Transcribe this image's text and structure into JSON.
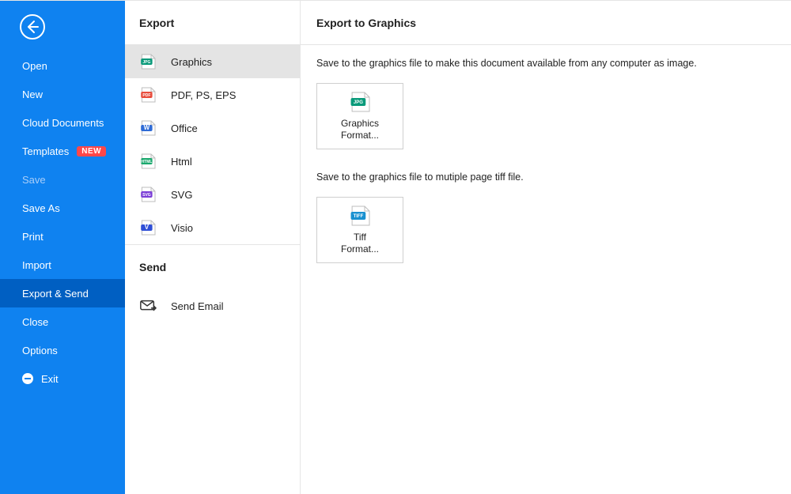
{
  "nav": {
    "items": [
      {
        "label": "Open"
      },
      {
        "label": "New"
      },
      {
        "label": "Cloud Documents"
      },
      {
        "label": "Templates",
        "badge": "NEW"
      },
      {
        "label": "Save",
        "disabled": true
      },
      {
        "label": "Save As"
      },
      {
        "label": "Print"
      },
      {
        "label": "Import"
      },
      {
        "label": "Export & Send",
        "active": true
      },
      {
        "label": "Close"
      },
      {
        "label": "Options"
      },
      {
        "label": "Exit",
        "exitIcon": true
      }
    ]
  },
  "middle": {
    "exportHeader": "Export",
    "exportItems": [
      {
        "label": "Graphics",
        "icon": "jpg",
        "selected": true
      },
      {
        "label": "PDF, PS, EPS",
        "icon": "pdf"
      },
      {
        "label": "Office",
        "icon": "word"
      },
      {
        "label": "Html",
        "icon": "html"
      },
      {
        "label": "SVG",
        "icon": "svg"
      },
      {
        "label": "Visio",
        "icon": "visio"
      }
    ],
    "sendHeader": "Send",
    "sendItems": [
      {
        "label": "Send Email",
        "icon": "email"
      }
    ]
  },
  "main": {
    "title": "Export to Graphics",
    "sections": [
      {
        "desc": "Save to the graphics file to make this document available from any computer as image.",
        "card": {
          "label": "Graphics Format...",
          "icon": "jpg"
        }
      },
      {
        "desc": "Save to the graphics file to mutiple page tiff file.",
        "card": {
          "label": "Tiff Format...",
          "icon": "tiff"
        }
      }
    ]
  },
  "icons": {
    "jpg": {
      "bg": "#0a9a7a",
      "text": "JPG"
    },
    "pdf": {
      "bg": "#e84d3d",
      "text": "PDF"
    },
    "word": {
      "bg": "#2f6bd6",
      "text": "W"
    },
    "html": {
      "bg": "#1aa86d",
      "text": "HTML"
    },
    "svg": {
      "bg": "#7b3ed6",
      "text": "SVG"
    },
    "visio": {
      "bg": "#2f4fd6",
      "text": "V"
    },
    "tiff": {
      "bg": "#1990d0",
      "text": "TIFF"
    }
  }
}
